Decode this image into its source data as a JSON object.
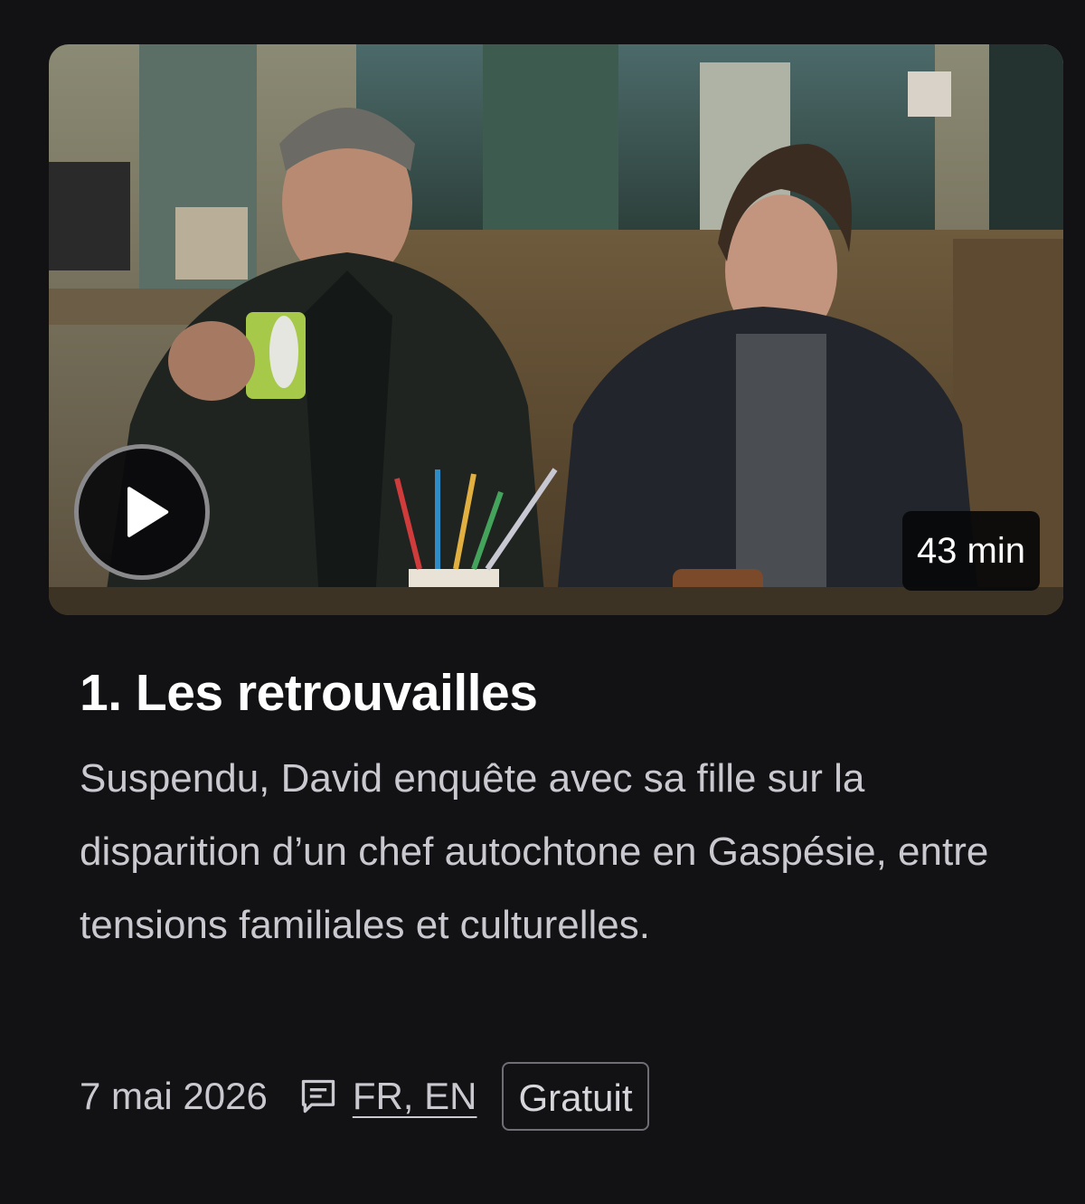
{
  "episode": {
    "duration": "43 min",
    "title": "1. Les retrouvailles",
    "description": "Suspendu, David enquête avec sa fille sur la disparition d’un chef autochtone en Gaspésie, entre tensions familiales et culturelles.",
    "date": "7 mai 2026",
    "languages": "FR, EN",
    "badge": "Gratuit"
  },
  "icons": {
    "play": "play-icon",
    "subtitles": "subtitles-icon"
  },
  "colors": {
    "background": "#121214",
    "text_primary": "#ffffff",
    "text_secondary": "#c9c9cf"
  }
}
